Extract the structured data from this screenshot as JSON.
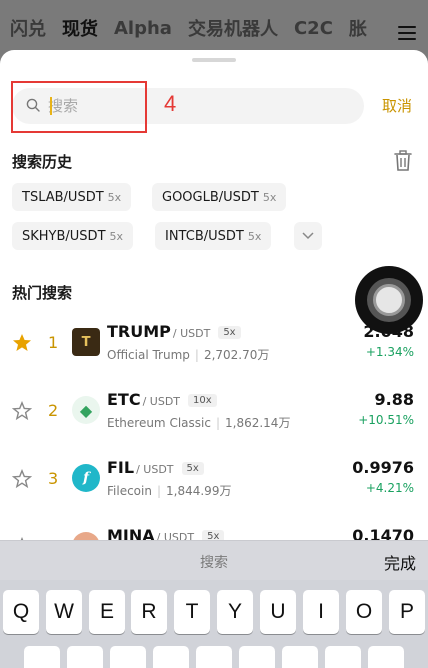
{
  "top_nav": {
    "tabs": [
      {
        "label": "闪兑"
      },
      {
        "label": "现货"
      },
      {
        "label": "Alpha"
      },
      {
        "label": "交易机器人"
      },
      {
        "label": "C2C"
      },
      {
        "label": "胀"
      }
    ],
    "active_index": 1
  },
  "search": {
    "placeholder": "搜索",
    "value": "",
    "cancel_label": "取消"
  },
  "annotation": {
    "number": "4"
  },
  "history": {
    "title": "搜索历史",
    "chips": [
      {
        "symbol": "TSLAB/USDT",
        "leverage": "5x"
      },
      {
        "symbol": "GOOGLB/USDT",
        "leverage": "5x"
      },
      {
        "symbol": "SKHYB/USDT",
        "leverage": "5x"
      },
      {
        "symbol": "INTCB/USDT",
        "leverage": "5x"
      }
    ]
  },
  "hot": {
    "title": "热门搜索",
    "items": [
      {
        "rank": "1",
        "symbol": "TRUMP",
        "quote": "/ USDT",
        "leverage": "5x",
        "name": "Official Trump",
        "volume": "2,702.70万",
        "price": "2.048",
        "change": "+1.34%",
        "starred": true,
        "logo_color": "#3a2a14",
        "logo_glyph": "T"
      },
      {
        "rank": "2",
        "symbol": "ETC",
        "quote": "/ USDT",
        "leverage": "10x",
        "name": "Ethereum Classic",
        "volume": "1,862.14万",
        "price": "9.88",
        "change": "+10.51%",
        "starred": false,
        "logo_color": "#33a35f",
        "logo_glyph": "◆"
      },
      {
        "rank": "3",
        "symbol": "FIL",
        "quote": "/ USDT",
        "leverage": "5x",
        "name": "Filecoin",
        "volume": "1,844.99万",
        "price": "0.9976",
        "change": "+4.21%",
        "starred": false,
        "logo_color": "#20b7c9",
        "logo_glyph": "f"
      },
      {
        "rank": "4",
        "symbol": "MINA",
        "quote": "/ USDT",
        "leverage": "5x",
        "name": "",
        "volume": "",
        "price": "0.1470",
        "change": "",
        "starred": false,
        "logo_color": "#e8a889",
        "logo_glyph": ""
      }
    ]
  },
  "keyboard": {
    "bar_title": "搜索",
    "done_label": "完成",
    "row1": [
      "Q",
      "W",
      "E",
      "R",
      "T",
      "Y",
      "U",
      "I",
      "O",
      "P"
    ]
  },
  "colors": {
    "accent": "#c99400",
    "positive": "#1aa160",
    "annotation": "#e53935"
  }
}
